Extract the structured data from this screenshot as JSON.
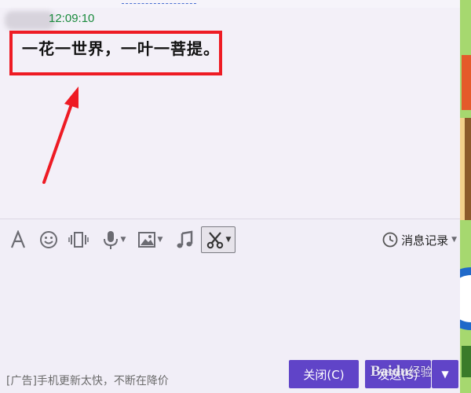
{
  "chat": {
    "timestamp": "12:09:10",
    "message": "一花一世界，一叶一菩提。"
  },
  "toolbar": {
    "font_icon": "font-A-icon",
    "emoji_icon": "smiley-icon",
    "shake_icon": "window-shake-icon",
    "voice_icon": "microphone-icon",
    "image_icon": "picture-icon",
    "music_icon": "music-note-icon",
    "screenshot_icon": "scissors-icon",
    "history_label": "消息记录"
  },
  "footer": {
    "ad_text": "[广告]手机更新太快，不断在降价",
    "close_button": "关闭(C)",
    "send_button": "发送(S)"
  },
  "watermark": {
    "text": "Baidu",
    "sub": "经验"
  },
  "colors": {
    "accent": "#6044c8",
    "highlight": "#ee1b24",
    "timestamp": "#1a8a3d"
  }
}
